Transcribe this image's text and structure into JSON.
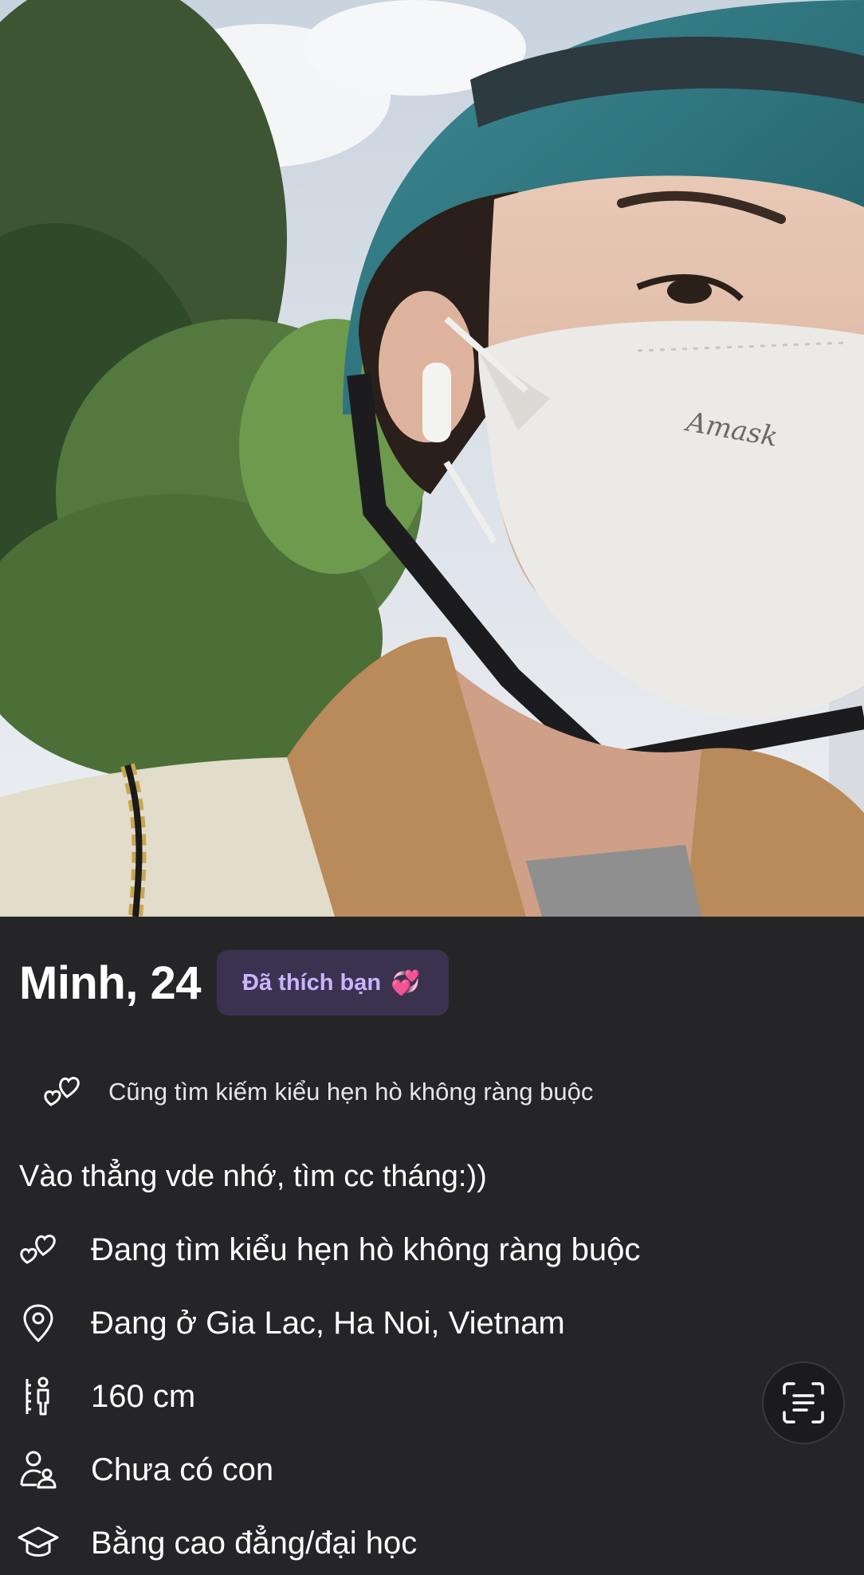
{
  "profile": {
    "name_age": "Minh, 24",
    "liked_badge": "Đã thích bạn",
    "liked_badge_emoji": "💞",
    "also_looking": "Cũng tìm kiếm kiểu hẹn hò không ràng buộc",
    "bio": "Vào thẳng vde nhớ, tìm cc tháng:))",
    "photo_mask_brand": "Amask"
  },
  "details": [
    {
      "icon": "hearts-icon",
      "text": "Đang tìm kiểu hẹn hò không ràng buộc"
    },
    {
      "icon": "location-pin-icon",
      "text": "Đang ở Gia Lac, Ha Noi, Vietnam"
    },
    {
      "icon": "height-icon",
      "text": "160 cm"
    },
    {
      "icon": "family-icon",
      "text": "Chưa có con"
    },
    {
      "icon": "graduation-cap-icon",
      "text": "Bằng cao đẳng/đại học"
    }
  ],
  "colors": {
    "background": "#252527",
    "badge_bg": "#3b3250",
    "badge_text": "#c9b4ff",
    "text": "#ffffff"
  }
}
